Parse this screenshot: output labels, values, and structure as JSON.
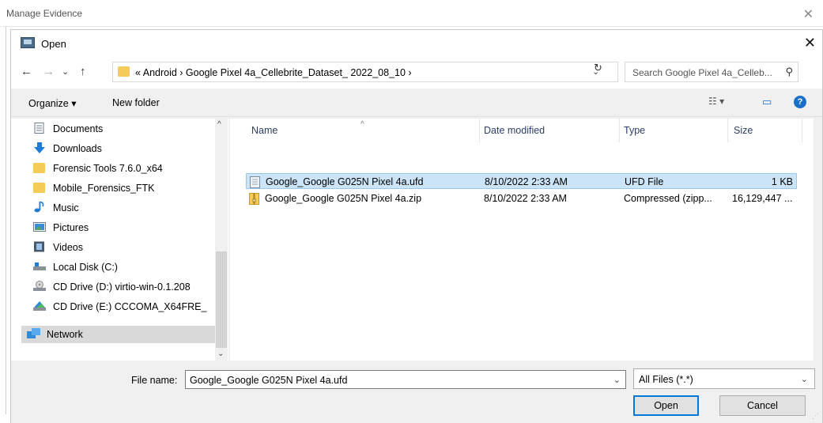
{
  "background_window": {
    "title": "Manage Evidence",
    "close_glyph": "✕"
  },
  "dialog": {
    "title": "Open",
    "close_glyph": "✕"
  },
  "navigation": {
    "back_glyph": "←",
    "forward_glyph": "→",
    "recent_glyph": "⌄",
    "up_glyph": "↑",
    "address_path": "« Android › Google Pixel 4a_Cellebrite_Dataset_ 2022_08_10 ›",
    "address_dropdown_glyph": "⌄",
    "refresh_glyph": "↻",
    "search_placeholder": "Search Google Pixel 4a_Celleb...",
    "search_icon_glyph": "⚲"
  },
  "toolbar": {
    "organize_label": "Organize ▾",
    "new_folder_label": "New folder",
    "view_glyph": "☷ ▾",
    "preview_glyph": "▭",
    "help_glyph": "?"
  },
  "sidebar": {
    "items": [
      {
        "label": "Documents",
        "icon": "documents-icon"
      },
      {
        "label": "Downloads",
        "icon": "downloads-icon"
      },
      {
        "label": "Forensic Tools 7.6.0_x64",
        "icon": "folder-icon"
      },
      {
        "label": "Mobile_Forensics_FTK",
        "icon": "folder-icon"
      },
      {
        "label": "Music",
        "icon": "music-icon"
      },
      {
        "label": "Pictures",
        "icon": "pictures-icon"
      },
      {
        "label": "Videos",
        "icon": "videos-icon"
      },
      {
        "label": "Local Disk (C:)",
        "icon": "drive-icon"
      },
      {
        "label": "CD Drive (D:) virtio-win-0.1.208",
        "icon": "cd-drive-icon"
      },
      {
        "label": "CD Drive (E:) CCCOMA_X64FRE_",
        "icon": "cd-drive-icon"
      },
      {
        "label": "Network",
        "icon": "network-icon"
      }
    ],
    "scroll_up_glyph": "^",
    "scroll_down_glyph": "⌄"
  },
  "file_list": {
    "columns": [
      "Name",
      "Date modified",
      "Type",
      "Size"
    ],
    "sort_glyph": "^",
    "rows": [
      {
        "name": "Google_Google G025N Pixel 4a.ufd",
        "date": "8/10/2022 2:33 AM",
        "type": "UFD File",
        "size": "1 KB",
        "selected": true
      },
      {
        "name": "Google_Google G025N Pixel 4a.zip",
        "date": "8/10/2022 2:33 AM",
        "type": "Compressed (zipp...",
        "size": "16,129,447 ...",
        "selected": false
      }
    ]
  },
  "bottom": {
    "file_name_label": "File name:",
    "file_name_value": "Google_Google G025N Pixel 4a.ufd",
    "file_name_drop_glyph": "⌄",
    "file_type_value": "All Files (*.*)",
    "file_type_drop_glyph": "⌄",
    "open_label": "Open",
    "cancel_label": "Cancel"
  },
  "colors": {
    "selection_bg": "#cce4f7",
    "selection_border": "#99c9ef",
    "primary_border": "#0078d7",
    "folder": "#f3cb56"
  }
}
